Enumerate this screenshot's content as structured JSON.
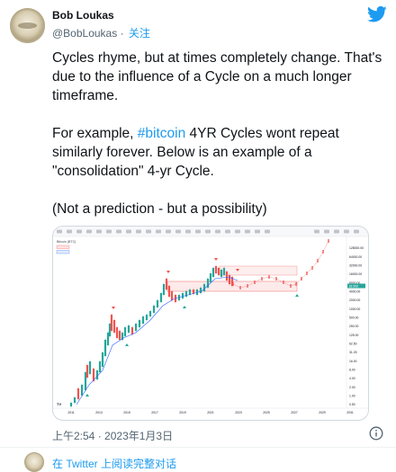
{
  "author": {
    "name": "Bob Loukas",
    "handle": "@BobLoukas",
    "separator": "·",
    "follow_label": "关注"
  },
  "tweet": {
    "paragraph1": "Cycles rhyme, but at times completely change. That's due to the influence of a Cycle on a much longer timeframe.",
    "paragraph2_pre": "For example, ",
    "hashtag": "#bitcoin",
    "paragraph2_post": " 4YR Cycles wont repeat similarly forever. Below is an example of a \"consolidation\" 4-yr Cycle.",
    "paragraph3": "(Not a prediction - but a possibility)"
  },
  "chart_data": {
    "type": "candlestick",
    "title": "Bitcoin (BTC)",
    "x_tick_labels": [
      "2011",
      "2013",
      "2015",
      "2017",
      "2019",
      "2021",
      "2023",
      "2025",
      "2027",
      "2029",
      "2031"
    ],
    "y_tick_labels": [
      "128000.00",
      "64000.00",
      "32000.00",
      "16000.00",
      "8000.00",
      "4000.00",
      "2000.00",
      "1000.00",
      "500.00",
      "250.00",
      "125.00",
      "62.50",
      "31.25",
      "16.00",
      "8.00",
      "4.00",
      "2.00",
      "1.00",
      "0.50"
    ],
    "y_scale": "log",
    "current_price_label": "18.50K",
    "cycle_top_markers": 4,
    "cycle_bottom_markers": 4,
    "colors": {
      "up": "#26a69a",
      "down": "#ef5350",
      "projection": "#ef5350",
      "ma": "#2962ff"
    }
  },
  "meta": {
    "time": "上午2:54",
    "separator": "·",
    "date": "2023年1月3日"
  },
  "footer": {
    "link_label": "在 Twitter 上阅读完整对话"
  },
  "colors": {
    "accent": "#1d9bf0",
    "text": "#0f1419",
    "secondary": "#536471"
  }
}
